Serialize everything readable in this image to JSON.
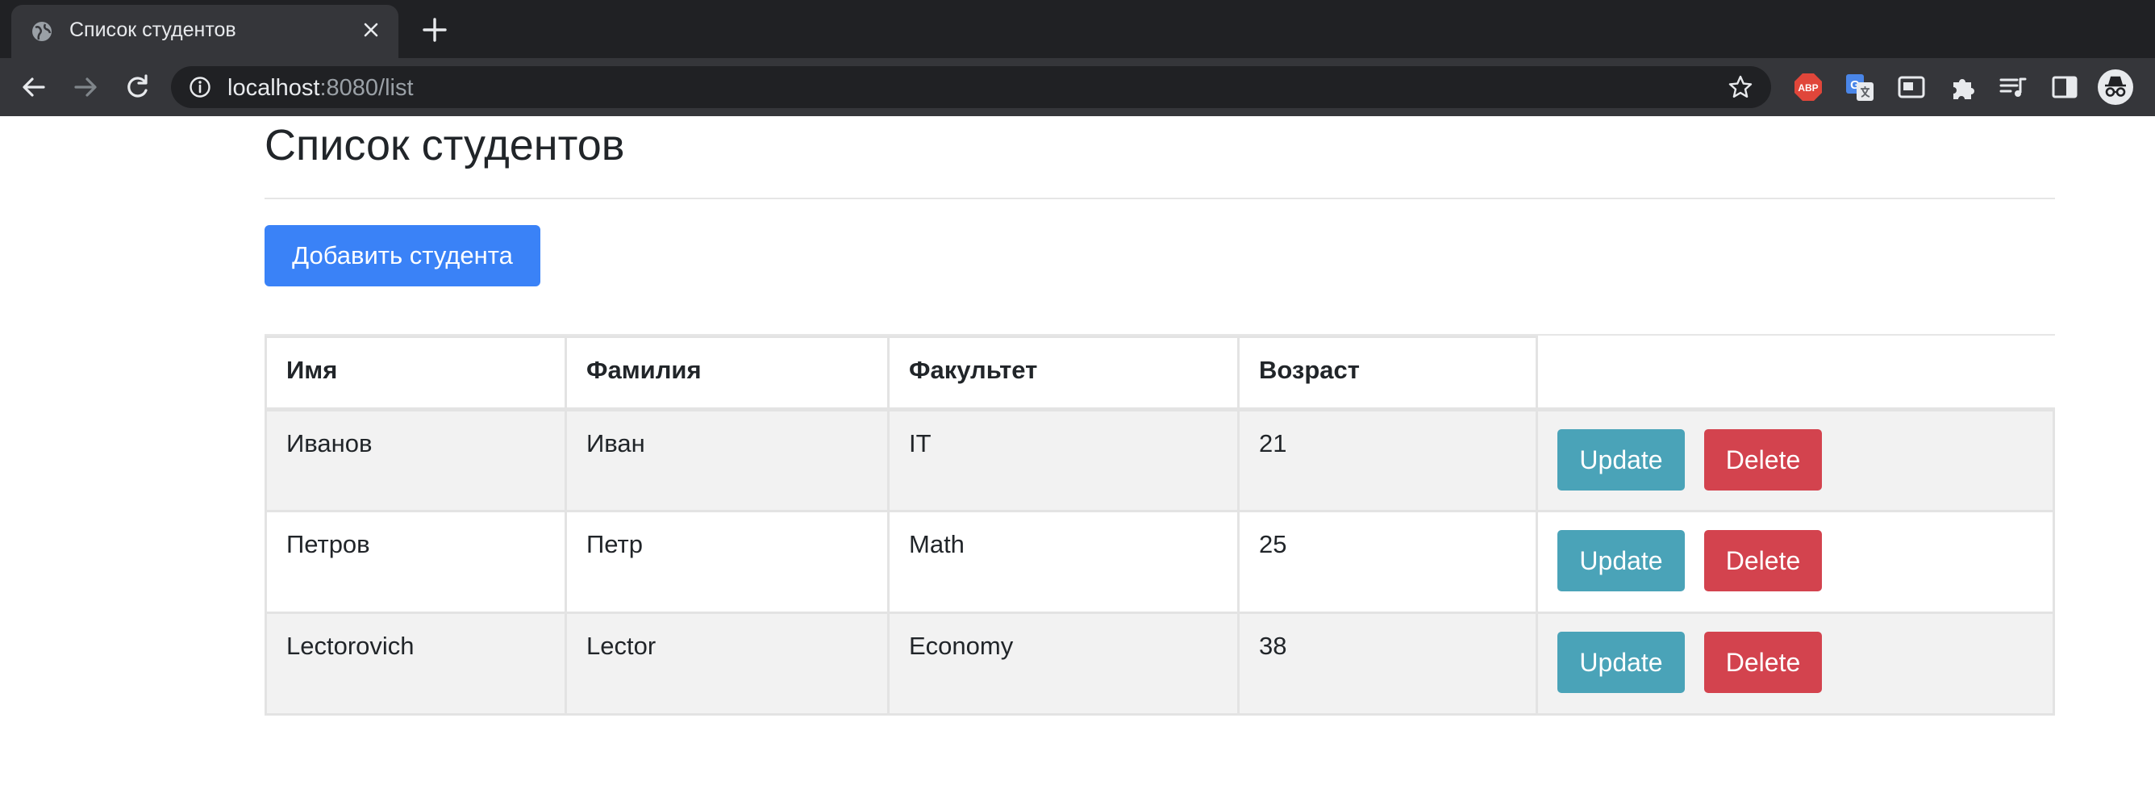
{
  "browser": {
    "tab": {
      "title": "Список студентов",
      "favicon": "globe-icon"
    },
    "address": {
      "host": "localhost",
      "rest": ":8080/list"
    },
    "extensions": [
      "adblock-plus-icon",
      "google-translate-icon",
      "picture-in-picture-icon",
      "puzzle-extensions-icon",
      "media-playlist-icon",
      "side-panel-icon",
      "incognito-profile-icon"
    ]
  },
  "page": {
    "title": "Список студентов",
    "add_button": "Добавить студента"
  },
  "table": {
    "headers": [
      "Имя",
      "Фамилия",
      "Факультет",
      "Возраст"
    ],
    "rows": [
      {
        "first": "Иванов",
        "last": "Иван",
        "faculty": "IT",
        "age": "21"
      },
      {
        "first": "Петров",
        "last": "Петр",
        "faculty": "Math",
        "age": "25"
      },
      {
        "first": "Lectorovich",
        "last": "Lector",
        "faculty": "Economy",
        "age": "38"
      }
    ],
    "update_label": "Update",
    "delete_label": "Delete"
  },
  "colors": {
    "primary": "#3a82f7",
    "info": "#4aa3b8",
    "danger": "#d3434e",
    "striped_row": "#f2f2f2"
  }
}
